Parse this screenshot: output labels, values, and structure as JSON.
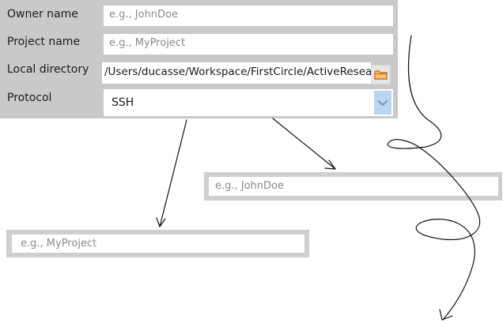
{
  "form": {
    "owner_label": "Owner name",
    "owner_placeholder": "e.g., JohnDoe",
    "project_label": "Project name",
    "project_placeholder": "e.g., MyProject",
    "directory_label": "Local directory",
    "directory_value": "/Users/ducasse/Workspace/FirstCircle/ActiveResea",
    "protocol_label": "Protocol",
    "protocol_value": "SSH"
  },
  "floating": {
    "owner_placeholder": "e.g., JohnDoe",
    "project_placeholder": "e.g., MyProject"
  },
  "icons": {
    "folder": "folder-icon",
    "dropdown": "chevron-down-icon"
  },
  "colors": {
    "panel_bg": "#c9c9c9",
    "dropdown_accent": "#b8d6f2",
    "folder_accent": "#e07a1f"
  }
}
